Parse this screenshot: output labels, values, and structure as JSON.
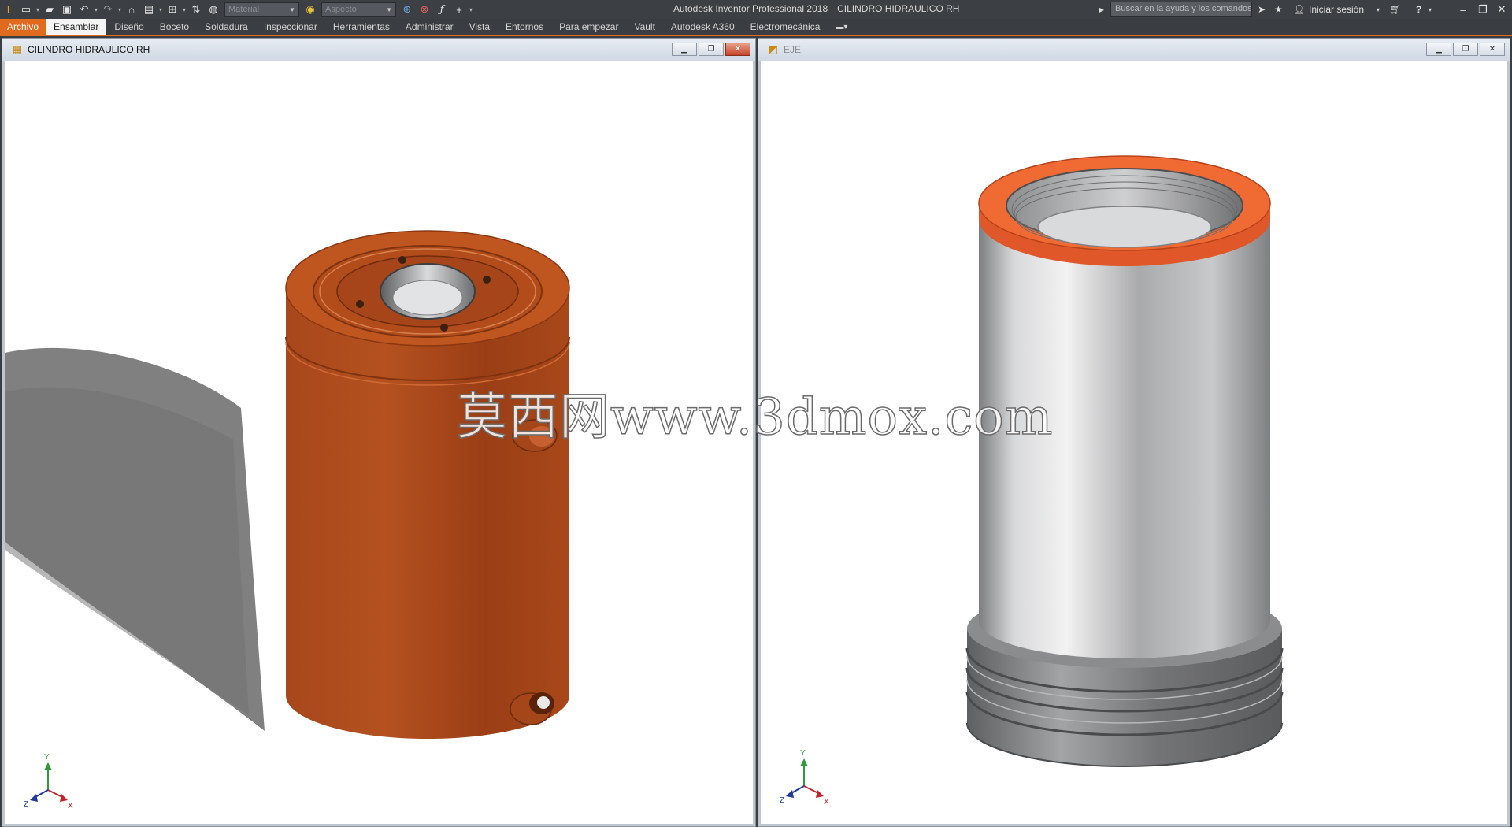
{
  "app": {
    "logo_glyph": "I",
    "title": "Autodesk Inventor Professional 2018",
    "document": "CILINDRO HIDRAULICO RH"
  },
  "quick_access": {
    "material_placeholder": "Material",
    "appearance_placeholder": "Aspecto",
    "icons": [
      "new-icon",
      "open-icon",
      "save-icon",
      "undo-icon",
      "redo-icon",
      "home-icon",
      "project-icon",
      "select-icon",
      "update-icon",
      "appearance-icon",
      "clear-override-icon",
      "parameters-icon",
      "measure-icon",
      "customize-icon"
    ]
  },
  "header_right": {
    "search_placeholder": "Buscar en la ayuda y los comandos...",
    "sign_in": "Iniciar sesión",
    "help_glyph": "?"
  },
  "ribbon": {
    "tabs": [
      "Archivo",
      "Ensamblar",
      "Diseño",
      "Boceto",
      "Soldadura",
      "Inspeccionar",
      "Herramientas",
      "Administrar",
      "Vista",
      "Entornos",
      "Para empezar",
      "Vault",
      "Autodesk A360",
      "Electromecánica"
    ],
    "active_tab": "Ensamblar"
  },
  "windows": {
    "left": {
      "title": "CILINDRO HIDRAULICO RH",
      "icon": "assembly-icon"
    },
    "right": {
      "title": "EJE",
      "icon": "part-icon"
    }
  },
  "triad": {
    "x": "X",
    "y": "Y",
    "z": "Z"
  },
  "watermark": "莫西网www.3dmox.com",
  "colors": {
    "accent": "#e06a1e",
    "cylinder_body": "#a5461a",
    "cylinder_top": "#c0561f",
    "steel": "#b8b9ba",
    "triad_x": "#c0272d",
    "triad_y": "#2e9a3a",
    "triad_z": "#1f3a9a"
  }
}
